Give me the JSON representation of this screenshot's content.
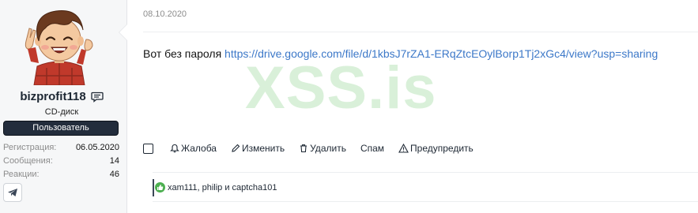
{
  "user": {
    "username": "bizprofit118",
    "title": "CD-диск",
    "role": "Пользователь",
    "stats": [
      {
        "label": "Регистрация:",
        "value": "06.05.2020"
      },
      {
        "label": "Сообщения:",
        "value": "14"
      },
      {
        "label": "Реакции:",
        "value": "46"
      }
    ],
    "contact_icon": "telegram-icon",
    "message_icon": "message-icon"
  },
  "post": {
    "date": "08.10.2020",
    "body_text": "Вот без пароля ",
    "link_text": "https://drive.google.com/file/d/1kbsJ7rZA1-ERqZtcEOylBorp1Tj2xGc4/view?usp=sharing",
    "watermark": "XSS.is"
  },
  "actions": {
    "report": "Жалоба",
    "edit": "Изменить",
    "delete": "Удалить",
    "spam": "Спам",
    "warn": "Предупредить"
  },
  "reactions": {
    "icon": "thumbs-up-icon",
    "text": "xam111, philip и captcha101"
  },
  "colors": {
    "link": "#3c78c8",
    "badge_bg": "#232d3c",
    "watermark": "#cdebcd",
    "like": "#4caf50"
  }
}
